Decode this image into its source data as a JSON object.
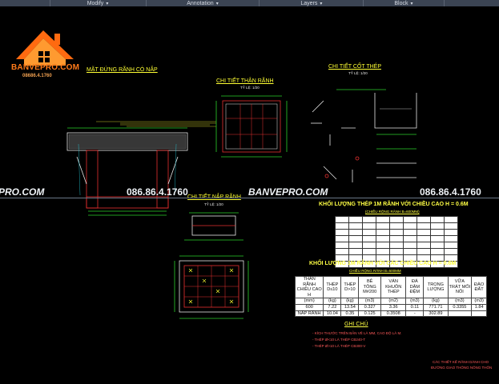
{
  "ribbon": {
    "panels": [
      {
        "label": "Modify"
      },
      {
        "label": "Annotation"
      },
      {
        "label": "Layers"
      },
      {
        "label": "Block"
      }
    ]
  },
  "logo": {
    "name": "BANVEPRO.COM",
    "phone": "08686.4.1760"
  },
  "titles": {
    "elevation": "MẶT ĐỨNG RÃNH CÓ NẮP",
    "elevation_scale": "TỶ LỆ: 1/20",
    "body_detail": "CHI TIẾT THÂN RÃNH",
    "body_scale": "TỶ LỆ: 1/20",
    "rebar_detail": "CHI TIẾT CỐT THÉP",
    "rebar_scale": "TỶ LỆ: 1/20",
    "cover_detail": "CHI TIẾT NẮP RÃNH",
    "cover_scale": "TỶ LỆ: 1/20"
  },
  "watermark": {
    "left_site": "PRO.COM",
    "phone_1": "086.86.4.1760",
    "center_site": "BANVEPRO.COM",
    "phone_2": "086.86.4.1760"
  },
  "table1": {
    "title": "KHỐI LƯỢNG THÉP 1M RÃNH VỚI CHIỀU CAO H = 0.6M",
    "subtitle": "(CHIỀU RỘNG RÃNH B=600MM)"
  },
  "table2": {
    "title": "KHỐI LƯỢNG 1M RÃNH VỚI CÁC CHIỀU CAO H = 0.6M",
    "subtitle": "CHIỀU RỘNG RÃNH B=600MM",
    "headers": [
      "THÂN RÃNH CHIỀU CAO H",
      "THÉP D≤10",
      "THÉP D>10",
      "BÊ TÔNG M#200",
      "VÁN KHUÔN THÉP",
      "ĐÁ DĂM ĐỆM",
      "TRỌNG LƯỢNG",
      "VỮA TRÁT MỐI NỐI",
      "ĐÀO ĐẤT"
    ],
    "units": [
      "(mm)",
      "(kg)",
      "(kg)",
      "(m3)",
      "(m2)",
      "(m3)",
      "(kg)",
      "(m3)",
      "(m3)"
    ],
    "rows": [
      [
        "600",
        "7.22",
        "13.54",
        "0.327",
        "3.36",
        "0.11",
        "771.71",
        "0.3355",
        "1.84"
      ],
      [
        "NẮP RÃNH",
        "10.04",
        "0.35",
        "0.125",
        "0.3508",
        "-",
        "302.89",
        "",
        ""
      ]
    ]
  },
  "notes": {
    "title": "GHI CHÚ",
    "lines": [
      "- KÍCH THƯỚC TRÊN BẢN VẼ LÀ MM, CAO ĐỘ LÀ M.",
      "- THÉP Ø<10 LÀ THÉP CB240-T",
      "- THÉP Ø>10 LÀ THÉP CB300-V"
    ]
  },
  "stamp": {
    "line1": "CÁC THIẾT KẾ RÃNH DÀNH CHO",
    "line2": "ĐƯỜNG GIAO THÔNG NÔNG THÔN"
  },
  "colors": {
    "background": "#000000",
    "ribbon": "#3b4453",
    "title": "#ffff33",
    "line_green": "#2bd12b",
    "line_red": "#e83030",
    "line_white": "#e8e8e8",
    "line_cyan": "#23d0e0",
    "logo_orange": "#ff7a1a"
  }
}
